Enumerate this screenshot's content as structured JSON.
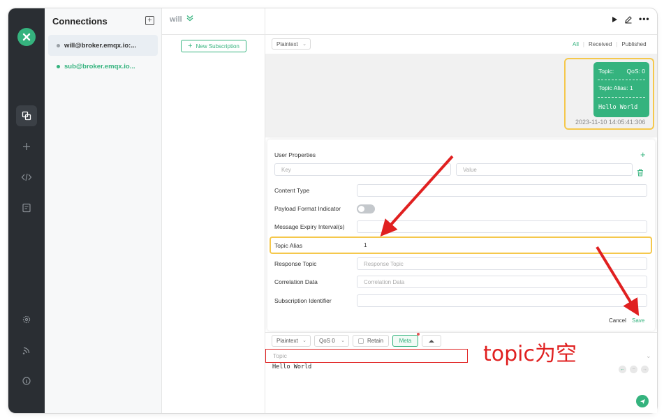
{
  "sidebar": {
    "title": "Connections",
    "connections": [
      {
        "name": "will@broker.emqx.io:...",
        "status_color": "#9aa0a6",
        "selected": true
      },
      {
        "name": "sub@broker.emqx.io...",
        "status_color": "#35b37e",
        "selected": false
      }
    ]
  },
  "header": {
    "connection_name": "will"
  },
  "topics": {
    "new_subscription_label": "New Subscription"
  },
  "messages": {
    "format": "Plaintext",
    "filters": {
      "all": "All",
      "received": "Received",
      "published": "Published",
      "active": "All"
    },
    "items": [
      {
        "topic_label": "Topic:",
        "qos": "QoS: 0",
        "topic_alias": "Topic Alias: 1",
        "payload": "Hello World",
        "time": "2023-11-10 14:05:41:306"
      }
    ]
  },
  "meta_form": {
    "user_properties_label": "User Properties",
    "key_placeholder": "Key",
    "value_placeholder": "Value",
    "content_type_label": "Content Type",
    "payload_format_label": "Payload Format Indicator",
    "payload_format_on": false,
    "message_expiry_label": "Message Expiry Interval(s)",
    "topic_alias_label": "Topic Alias",
    "topic_alias_value": "1",
    "response_topic_label": "Response Topic",
    "response_topic_placeholder": "Response Topic",
    "correlation_data_label": "Correlation Data",
    "correlation_data_placeholder": "Correlation Data",
    "subscription_identifier_label": "Subscription Identifier",
    "cancel_label": "Cancel",
    "save_label": "Save"
  },
  "composer": {
    "format": "Plaintext",
    "qos": "QoS 0",
    "retain_label": "Retain",
    "meta_label": "Meta",
    "topic_placeholder": "Topic",
    "payload": "Hello World"
  },
  "annotation": {
    "text": "topic为空",
    "color": "#e02020"
  },
  "colors": {
    "accent": "#35b37e",
    "highlight": "#f5c84c",
    "rail": "#2a2e33"
  }
}
